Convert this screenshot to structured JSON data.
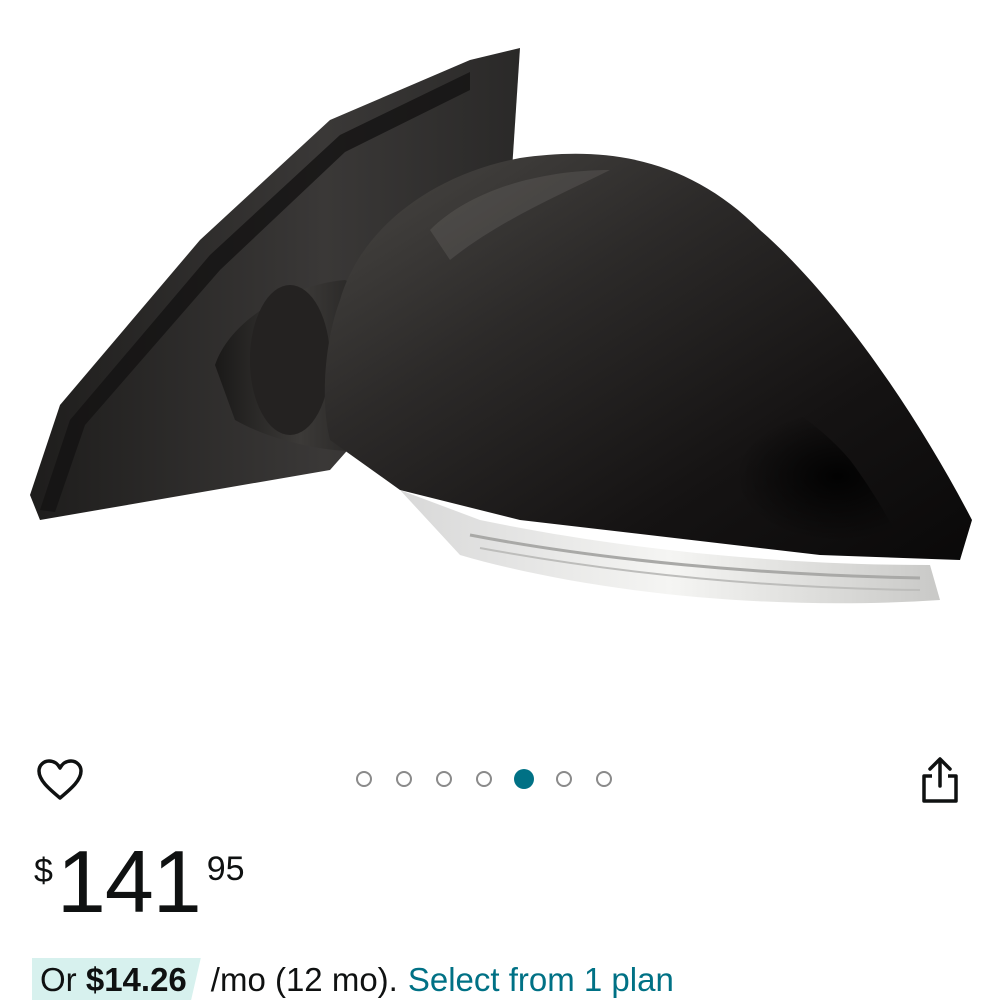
{
  "product": {
    "image_alt": "Black side view mirror with LED turn signal",
    "carousel": {
      "total": 7,
      "active_index": 4
    }
  },
  "actions": {
    "wishlist_icon": "heart-icon",
    "share_icon": "share-icon"
  },
  "price": {
    "symbol": "$",
    "whole": "141",
    "fraction": "95"
  },
  "installment": {
    "prefix": "Or",
    "amount": "$14.26",
    "term": "/mo (12 mo).",
    "plan_link": "Select from 1 plan"
  },
  "colors": {
    "accent": "#007185",
    "text": "#0f1111",
    "highlight": "#d7f1ee"
  }
}
